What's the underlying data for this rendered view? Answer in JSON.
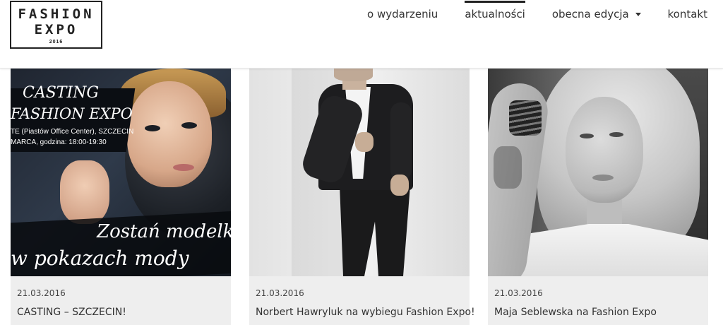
{
  "logo": {
    "line1": "FASHION",
    "line2": "EXPO",
    "year": "2016"
  },
  "nav": {
    "items": [
      {
        "label": "o wydarzeniu"
      },
      {
        "label": "aktualności"
      },
      {
        "label": "obecna edycja"
      },
      {
        "label": "kontakt"
      }
    ],
    "active": "aktualności"
  },
  "cards": [
    {
      "date": "21.03.2016",
      "title": "CASTING – SZCZECIN!",
      "image": {
        "icon": "casting-poster-image",
        "lines": [
          "CASTING",
          "FASHION EXPO",
          "TE (Piastów Office Center), SZCZECIN",
          "MARCA, godzina: 18:00-19:30",
          "Zostań modelk",
          "w pokazach mody"
        ]
      }
    },
    {
      "date": "21.03.2016",
      "title": "Norbert Hawryluk na wybiegu Fashion Expo!",
      "image": {
        "icon": "model-suit-photo"
      }
    },
    {
      "date": "21.03.2016",
      "title": "Maja Seblewska na Fashion Expo",
      "image": {
        "icon": "model-portrait-photo"
      }
    }
  ],
  "colors": {
    "card_background": "#eeeeee",
    "text": "#333333",
    "nav_active_bar": "#222222"
  }
}
